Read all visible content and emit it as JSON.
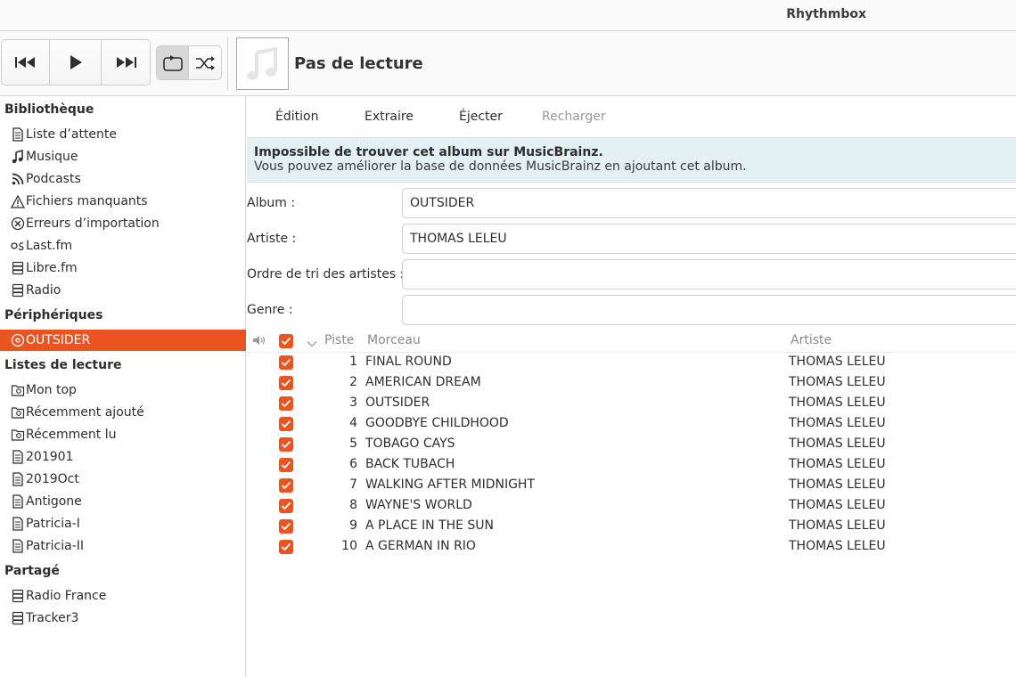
{
  "app": {
    "title": "Rhythmbox"
  },
  "colors": {
    "accent": "#e95420",
    "info_bg": "#e3f0f4"
  },
  "player": {
    "buttons": [
      {
        "name": "previous",
        "icon": "skip-back-icon"
      },
      {
        "name": "play",
        "icon": "play-icon"
      },
      {
        "name": "next",
        "icon": "skip-forward-icon"
      }
    ],
    "modes": [
      {
        "name": "repeat",
        "icon": "repeat-icon",
        "active": true
      },
      {
        "name": "shuffle",
        "icon": "shuffle-icon",
        "active": false
      }
    ],
    "now_playing": "Pas de lecture",
    "album_art_icon": "music-note-icon"
  },
  "sidebar": {
    "library_title": "Bibliothèque",
    "library": [
      {
        "label": "Liste d’attente",
        "icon": "document-icon"
      },
      {
        "label": "Musique",
        "icon": "music-note-icon"
      },
      {
        "label": "Podcasts",
        "icon": "rss-icon"
      },
      {
        "label": "Fichiers manquants",
        "icon": "warning-icon"
      },
      {
        "label": "Erreurs d’importation",
        "icon": "error-circle-icon"
      },
      {
        "label": "Last.fm",
        "icon": "lastfm-icon"
      },
      {
        "label": "Libre.fm",
        "icon": "server-icon"
      },
      {
        "label": "Radio",
        "icon": "server-icon"
      }
    ],
    "devices_title": "Périphériques",
    "devices": [
      {
        "label": "OUTSIDER",
        "icon": "disc-icon",
        "selected": true
      }
    ],
    "playlists_title": "Listes de lecture",
    "playlists": [
      {
        "label": "Mon top",
        "icon": "smart-playlist-icon"
      },
      {
        "label": "Récemment ajouté",
        "icon": "smart-playlist-icon"
      },
      {
        "label": "Récemment lu",
        "icon": "smart-playlist-icon"
      },
      {
        "label": "201901",
        "icon": "document-icon"
      },
      {
        "label": "2019Oct",
        "icon": "document-icon"
      },
      {
        "label": "Antigone",
        "icon": "document-icon"
      },
      {
        "label": "Patricia-I",
        "icon": "document-icon"
      },
      {
        "label": "Patricia-II",
        "icon": "document-icon"
      }
    ],
    "shared_title": "Partagé",
    "shared": [
      {
        "label": "Radio France",
        "icon": "server-icon"
      },
      {
        "label": "Tracker3",
        "icon": "server-icon"
      }
    ]
  },
  "main": {
    "actions": {
      "edit": "Édition",
      "extract": "Extraire",
      "eject": "Éjecter",
      "reload": "Recharger"
    },
    "info": {
      "title": "Impossible de trouver cet album sur MusicBrainz.",
      "desc": "Vous pouvez améliorer la base de données MusicBrainz en ajoutant cet album."
    },
    "fields": {
      "album_label": "Album :",
      "album_value": "OUTSIDER",
      "artist_label": "Artiste :",
      "artist_value": "THOMAS LELEU",
      "sort_label": "Ordre de tri des artistes :",
      "sort_value": "",
      "genre_label": "Genre :",
      "genre_value": ""
    },
    "columns": {
      "track": "Piste",
      "title": "Morceau",
      "artist": "Artiste"
    },
    "tracks": [
      {
        "num": "1",
        "title": "FINAL ROUND",
        "artist": "THOMAS LELEU"
      },
      {
        "num": "2",
        "title": "AMERICAN DREAM",
        "artist": "THOMAS LELEU"
      },
      {
        "num": "3",
        "title": "OUTSIDER",
        "artist": "THOMAS LELEU"
      },
      {
        "num": "4",
        "title": "GOODBYE CHILDHOOD",
        "artist": "THOMAS LELEU"
      },
      {
        "num": "5",
        "title": "TOBAGO CAYS",
        "artist": "THOMAS LELEU"
      },
      {
        "num": "6",
        "title": "BACK TUBACH",
        "artist": "THOMAS LELEU"
      },
      {
        "num": "7",
        "title": "WALKING AFTER MIDNIGHT",
        "artist": "THOMAS LELEU"
      },
      {
        "num": "8",
        "title": "WAYNE'S WORLD",
        "artist": "THOMAS LELEU"
      },
      {
        "num": "9",
        "title": "A PLACE IN THE SUN",
        "artist": "THOMAS LELEU"
      },
      {
        "num": "10",
        "title": "A GERMAN IN RIO",
        "artist": "THOMAS LELEU"
      }
    ]
  }
}
